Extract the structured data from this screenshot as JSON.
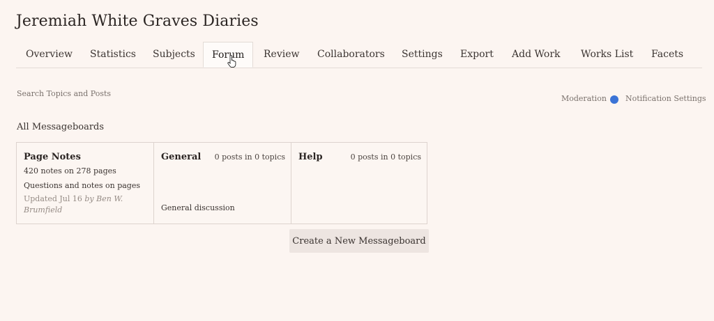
{
  "page": {
    "title": "Jeremiah White Graves Diaries"
  },
  "tabs": [
    {
      "label": "Overview"
    },
    {
      "label": "Statistics"
    },
    {
      "label": "Subjects"
    },
    {
      "label": "Forum",
      "active": true
    },
    {
      "label": "Review"
    },
    {
      "label": "Collaborators"
    },
    {
      "label": "Settings"
    },
    {
      "label": "Export"
    },
    {
      "label": "Add Work"
    },
    {
      "label": "Works List"
    },
    {
      "label": "Facets"
    }
  ],
  "toolbar": {
    "search_label": "Search Topics and Posts",
    "moderation_label": "Moderation",
    "notification_label": "Notification Settings",
    "moderation_dot_color": "#3b73d6"
  },
  "section": {
    "heading": "All Messageboards"
  },
  "boards": [
    {
      "name": "Page Notes",
      "stats": "420 notes on 278 pages",
      "description": "Questions and notes on pages",
      "updated": "Updated Jul 16",
      "updated_by": "by Ben W. Brumfield"
    },
    {
      "name": "General",
      "count": "0 posts in 0 topics",
      "description": "General discussion"
    },
    {
      "name": "Help",
      "count": "0 posts in 0 topics"
    }
  ],
  "actions": {
    "create_label": "Create a New Messageboard"
  },
  "colors": {
    "background": "#fcf5f1",
    "button": "#ede5e1"
  }
}
